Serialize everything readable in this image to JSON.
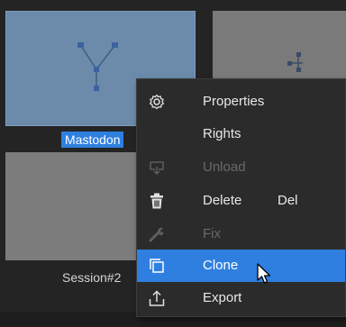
{
  "thumbnails": [
    {
      "caption": "Mastodon"
    },
    {
      "caption": "Session#2"
    }
  ],
  "context_menu": {
    "items": [
      {
        "label": "Properties",
        "icon": "gear-icon",
        "enabled": true
      },
      {
        "label": "Rights",
        "icon": "",
        "enabled": true
      },
      {
        "label": "Unload",
        "icon": "unload-icon",
        "enabled": false
      },
      {
        "label": "Delete",
        "shortcut": "Del",
        "icon": "trash-icon",
        "enabled": true
      },
      {
        "label": "Fix",
        "icon": "wrench-icon",
        "enabled": false
      },
      {
        "label": "Clone",
        "icon": "clone-icon",
        "enabled": true,
        "highlighted": true
      },
      {
        "label": "Export",
        "icon": "export-icon",
        "enabled": true
      }
    ]
  },
  "colors": {
    "selection": "#2f7fe0",
    "menu_background": "#2b2b2b",
    "disabled_text": "#6a6a6a"
  }
}
